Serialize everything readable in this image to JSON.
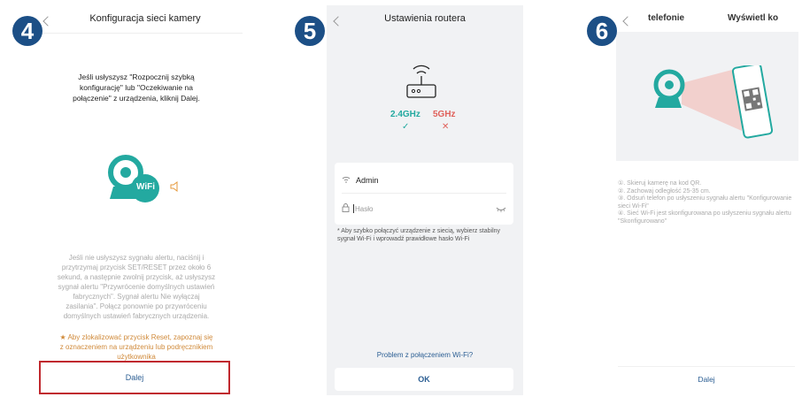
{
  "steps": [
    "4",
    "5",
    "6"
  ],
  "p4": {
    "title": "Konfiguracja sieci kamery",
    "instruction": "Jeśli usłyszysz \"Rozpocznij szybką konfigurację\" lub \"Oczekiwanie na połączenie\" z urządzenia, kliknij Dalej.",
    "wifi_label": "WiFi",
    "help_text": "Jeśli nie usłyszysz sygnału alertu, naciśnij i przytrzymaj przycisk SET/RESET przez około 6 sekund, a następnie zwolnij przycisk, aż usłyszysz sygnał alertu \"Przywrócenie domyślnych ustawień fabrycznych\". Sygnał alertu Nie wyłączaj zasilania\". Połącz ponownie po przywróceniu domyślnych ustawień fabrycznych urządzenia.",
    "warning_text": "★ Aby zlokalizować przycisk Reset, zapoznaj się z oznaczeniem na urządzeniu lub podręcznikiem użytkownika",
    "next_label": "Dalej",
    "highlight_color": "#c0282e"
  },
  "p5": {
    "title": "Ustawienia routera",
    "band_24": "2.4GHz",
    "band_5": "5GHz",
    "check_mark": "✓",
    "cross_mark": "✕",
    "ssid": "Admin",
    "password_placeholder": "Hasło",
    "note": "* Aby szybko połączyć urządzenie z siecią, wybierz stabilny sygnał Wi-Fi i wprowadź prawidłowe hasło Wi-Fi",
    "problem_link": "Problem z połączeniem Wi-Fi?",
    "ok_label": "OK",
    "accent_color": "#23a9a0",
    "bad_color": "#e0615b"
  },
  "p6": {
    "tab_left": "telefonie",
    "tab_right": "Wyświetl ko",
    "steps_text": [
      "①. Skieruj kamerę na kod QR.",
      "②. Zachowaj odległość 25-35 cm.",
      "③. Odsuń telefon po usłyszeniu sygnału alertu \"Konfigurowanie sieci Wi-Fi\"",
      "④. Sieć Wi-Fi jest skonfigurowana po usłyszeniu sygnału alertu \"Skonfigurowano\""
    ],
    "next_label": "Dalej"
  }
}
